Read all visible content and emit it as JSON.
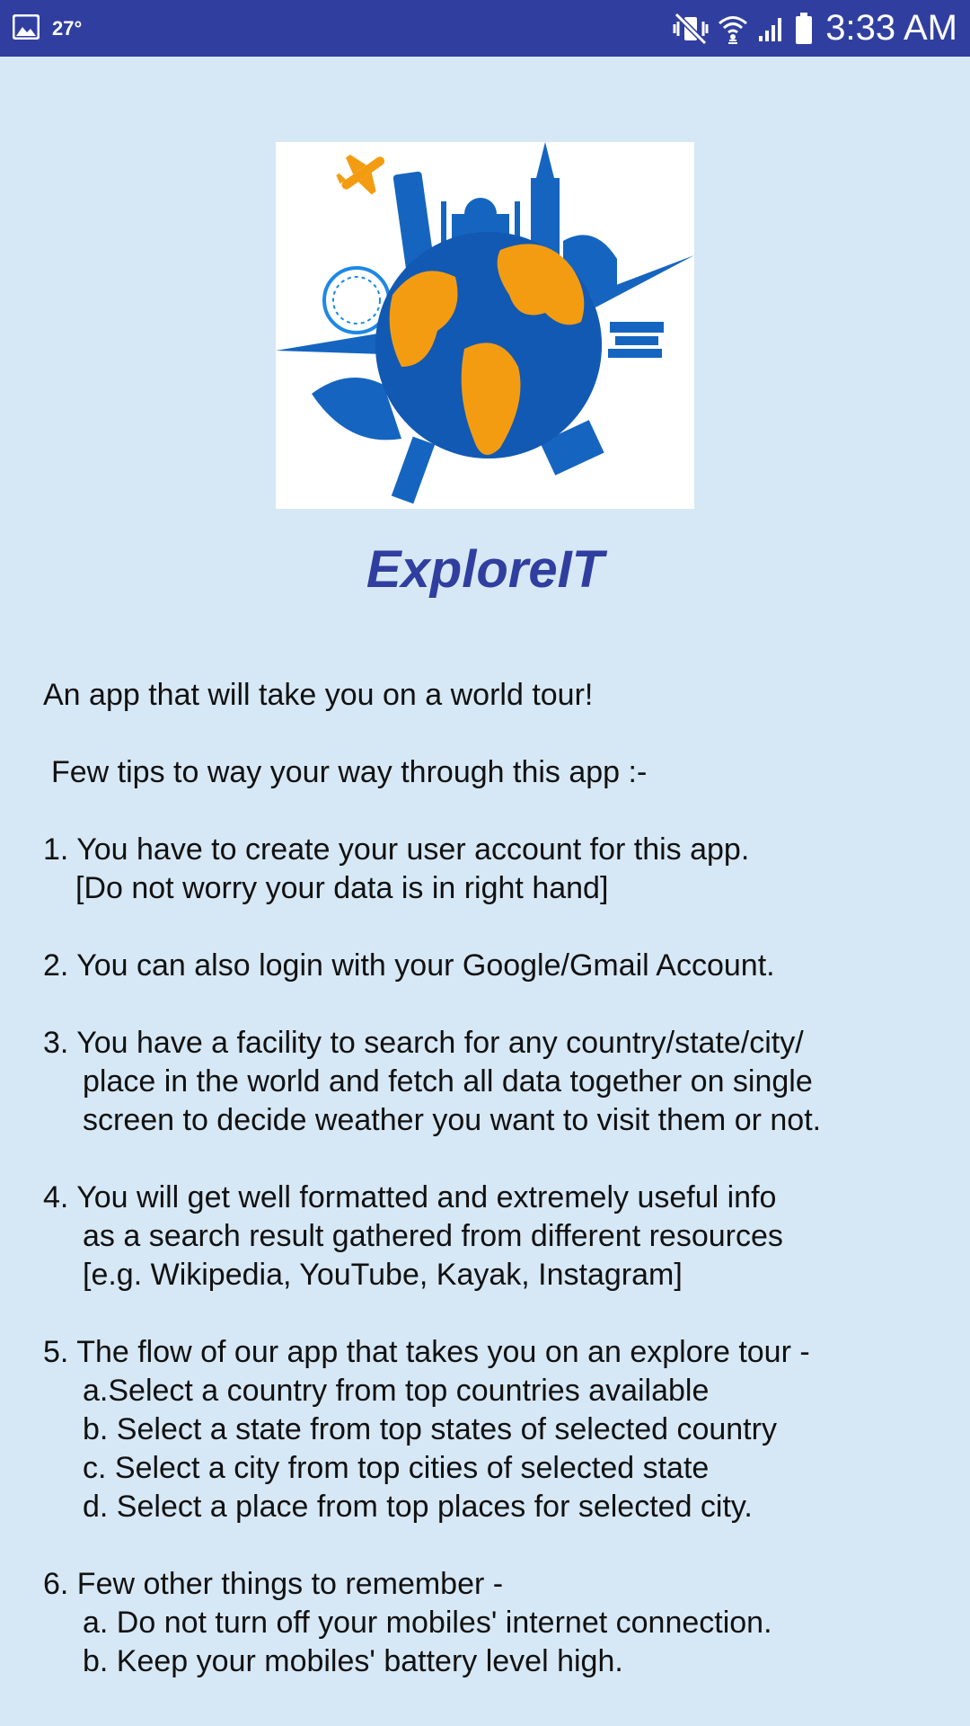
{
  "status_bar": {
    "temperature": "27°",
    "time": "3:33 AM"
  },
  "icons": {
    "gallery": "image-icon",
    "mute": "vibrate-mute-icon",
    "wifi": "wifi-icon",
    "signal": "cellular-signal-icon",
    "battery": "battery-icon"
  },
  "colors": {
    "status_bar": "#303f9f",
    "background": "#d6e8f5",
    "title": "#303f9f",
    "logo_blue": "#1565c0",
    "logo_orange": "#f39c12"
  },
  "app": {
    "title": "ExploreIT",
    "logo": "world-tour-logo"
  },
  "content": {
    "intro": "An app that will take you on a world tour!",
    "tips_heading": "Few tips to way your way through this app :-",
    "tip1": {
      "line1": "1. You have to create your user account for this app.",
      "line2": "[Do not worry your data is in right hand]"
    },
    "tip2": "2. You can also login with your Google/Gmail Account.",
    "tip3": {
      "line1": "3. You have a facility to search for any country/state/city/",
      "line2": "place in the world and fetch all data together on single",
      "line3": "screen to decide weather you want to visit them or not."
    },
    "tip4": {
      "line1": "4. You will get well formatted and extremely useful info",
      "line2": "as a search result gathered from different resources",
      "line3": "[e.g. Wikipedia, YouTube, Kayak, Instagram]"
    },
    "tip5": {
      "line1": "5. The flow of our app that takes you on an explore tour -",
      "a": "a.Select a country from top countries available",
      "b": "b. Select a state from top states of selected country",
      "c": "c. Select a city from top cities of selected state",
      "d": "d. Select a place from top places for selected city."
    },
    "tip6": {
      "line1": "6. Few other things to remember -",
      "a": "a. Do not turn off your mobiles' internet connection.",
      "b": "b. Keep your mobiles' battery level high."
    }
  }
}
